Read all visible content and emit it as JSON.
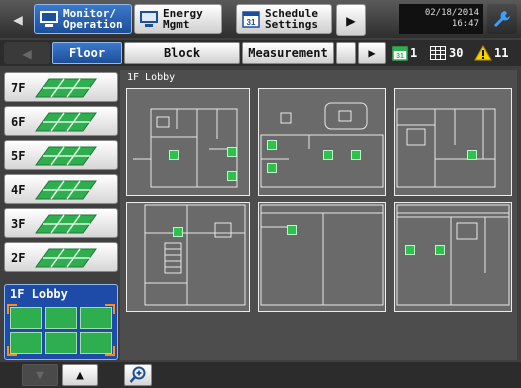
{
  "header": {
    "tabs": [
      {
        "label": "Monitor/\nOperation",
        "icon": "monitor-icon",
        "active": true
      },
      {
        "label": "Energy\nMgmt",
        "icon": "monitor-icon",
        "active": false
      },
      {
        "label": "Schedule\nSettings",
        "icon": "calendar-icon",
        "active": false
      }
    ],
    "date": "02/18/2014",
    "time": "16:47"
  },
  "subnav": {
    "tabs": [
      {
        "label": "Floor",
        "active": true
      },
      {
        "label": "Block",
        "active": false
      },
      {
        "label": "Measurement",
        "active": false
      }
    ],
    "status": {
      "schedule_count": "1",
      "grid_count": "30",
      "alert_count": "11"
    }
  },
  "floors": [
    {
      "label": "7F"
    },
    {
      "label": "6F"
    },
    {
      "label": "5F"
    },
    {
      "label": "4F"
    },
    {
      "label": "3F"
    },
    {
      "label": "2F"
    },
    {
      "label": "1F Lobby",
      "selected": true
    }
  ],
  "main": {
    "area_label": "1F Lobby",
    "panel_count": 6
  },
  "colors": {
    "active_blue": "#1e4aa8",
    "unit_green": "#2fc14d",
    "alert_yellow": "#f5d400"
  }
}
